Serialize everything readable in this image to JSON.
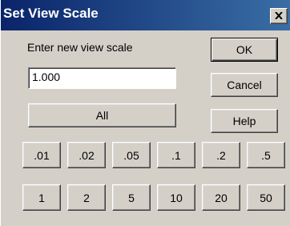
{
  "dialog": {
    "title": "Set View Scale",
    "prompt": "Enter new view scale",
    "scale_value": "1.000"
  },
  "buttons": {
    "ok": "OK",
    "cancel": "Cancel",
    "help": "Help",
    "all": "All"
  },
  "scale_presets": {
    "row1": [
      ".01",
      ".02",
      ".05",
      ".1",
      ".2",
      ".5"
    ],
    "row2": [
      "1",
      "2",
      "5",
      "10",
      "20",
      "50"
    ]
  },
  "colors": {
    "titlebar_start": "#0a246a",
    "titlebar_end": "#3a6ea5",
    "face": "#d4d0c8"
  }
}
